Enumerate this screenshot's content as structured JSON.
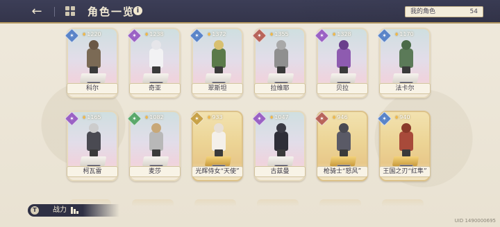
{
  "header": {
    "back_icon": "←",
    "title": "角色一览",
    "info_icon": "i",
    "my_chars_label": "我的角色",
    "my_chars_count": "54"
  },
  "cards": [
    {
      "name": "科尔",
      "power": "1220",
      "level": "36",
      "element_color": "#5a84c8",
      "frame": "normal",
      "head": "#6b5845",
      "body": "#7b6a55"
    },
    {
      "name": "奇亚",
      "power": "1238",
      "level": "36",
      "element_color": "#9a62c4",
      "frame": "normal",
      "head": "#e6e6ea",
      "body": "#f2f2f4"
    },
    {
      "name": "翠斯坦",
      "power": "1372",
      "level": "36",
      "element_color": "#5a84c8",
      "frame": "normal",
      "head": "#d8c070",
      "body": "#5a7a4a"
    },
    {
      "name": "拉维耶",
      "power": "1355",
      "level": "36",
      "element_color": "#b8645a",
      "frame": "normal",
      "head": "#a8a8a8",
      "body": "#8f8f8f"
    },
    {
      "name": "贝拉",
      "power": "1328",
      "level": "36",
      "element_color": "#9a62c4",
      "frame": "normal",
      "head": "#6a3f8c",
      "body": "#8e5bb0"
    },
    {
      "name": "法卡尔",
      "power": "1170",
      "level": "36",
      "element_color": "#5a84c8",
      "frame": "normal",
      "head": "#4a6a48",
      "body": "#5b7a58"
    },
    {
      "name": "柯瓦雷",
      "power": "1165",
      "level": "36",
      "element_color": "#9a62c4",
      "frame": "normal",
      "head": "#cccccc",
      "body": "#4a4a52"
    },
    {
      "name": "麦莎",
      "power": "1082",
      "level": "36",
      "element_color": "#5aa86a",
      "frame": "normal",
      "head": "#c8a878",
      "body": "#b8b8b8"
    },
    {
      "name": "光辉侍女“天使”",
      "power": "933",
      "level": "36",
      "element_color": "#c8a248",
      "frame": "gold",
      "head": "#e8e0d6",
      "body": "#f4f0ea"
    },
    {
      "name": "古兹曼",
      "power": "1047",
      "level": "36",
      "element_color": "#9a62c4",
      "frame": "normal",
      "head": "#3a3a44",
      "body": "#2e2e38"
    },
    {
      "name": "枪骑士“怒风”",
      "power": "946",
      "level": "30",
      "element_color": "#b8645a",
      "frame": "gold",
      "head": "#4a4a52",
      "body": "#5a5a66"
    },
    {
      "name": "王国之刃“红隼”",
      "power": "940",
      "level": "28",
      "element_color": "#5a84c8",
      "frame": "gold",
      "head": "#8a3a2a",
      "body": "#a84a3a"
    }
  ],
  "bottom": {
    "sort_icon": "T",
    "sort_label": "战力"
  },
  "uid": "UID 1490000695"
}
